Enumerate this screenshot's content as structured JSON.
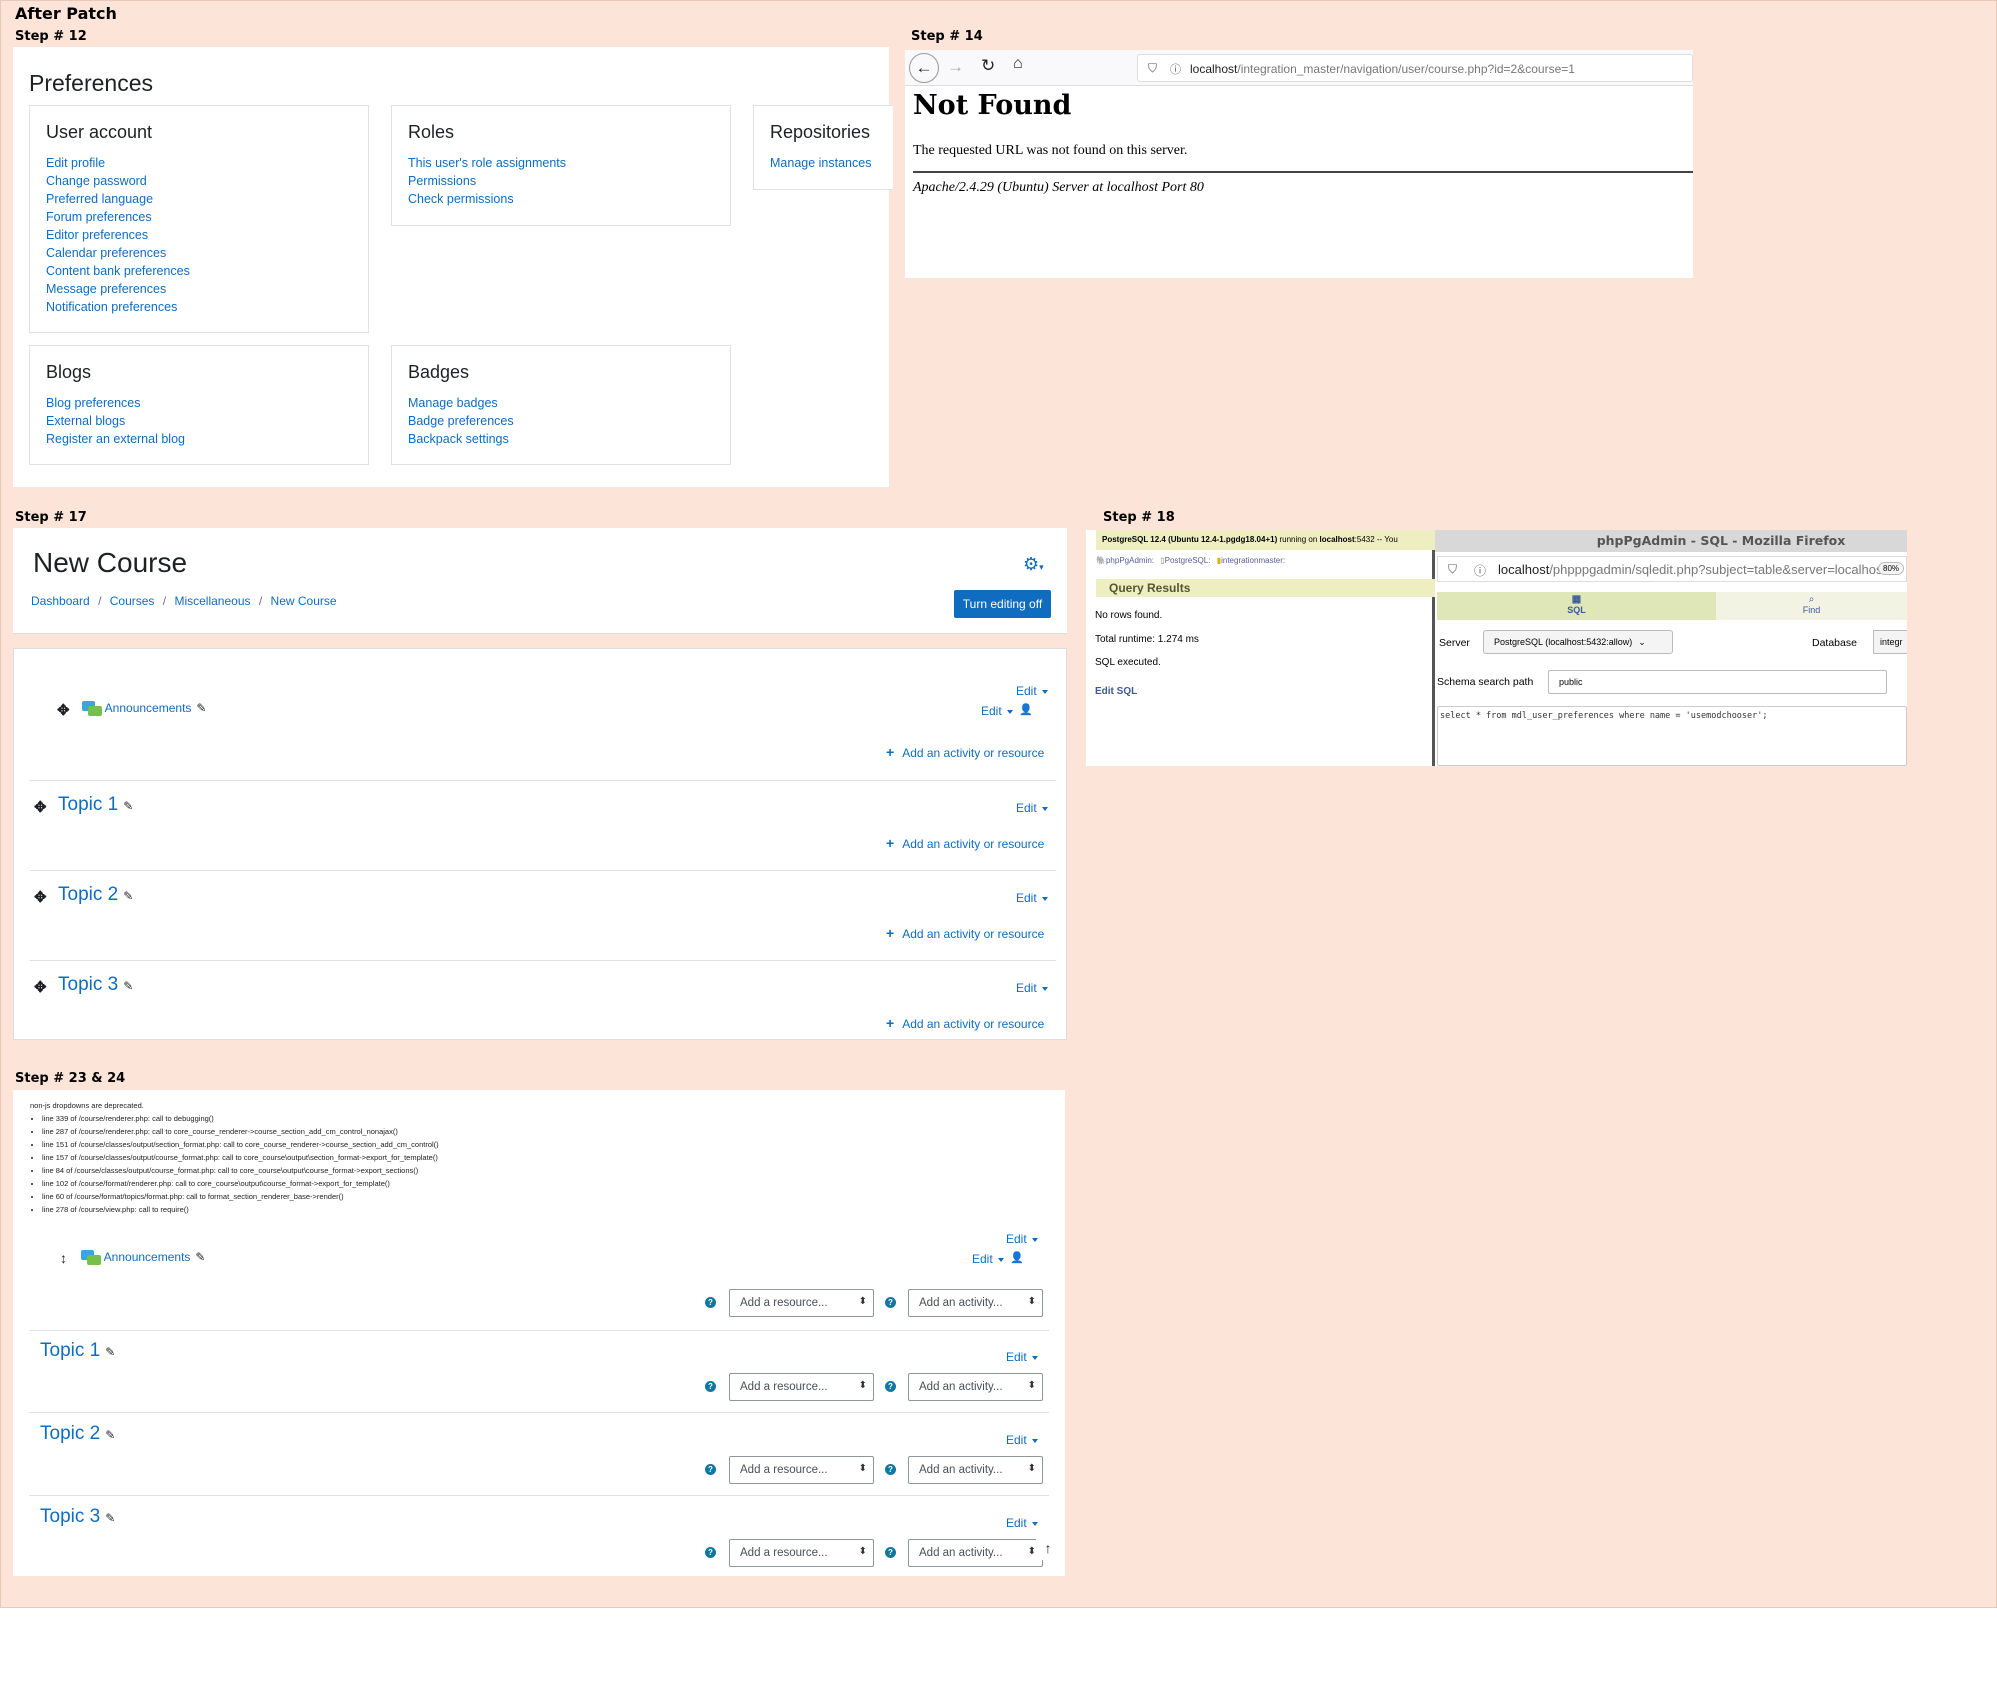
{
  "title": "After Patch",
  "steps": {
    "s12": "Step # 12",
    "s14": "Step # 14",
    "s17": "Step # 17",
    "s18": "Step # 18",
    "s2324": "Step # 23 & 24"
  },
  "preferences": {
    "title": "Preferences",
    "user_account": {
      "heading": "User account",
      "links": [
        "Edit profile",
        "Change password",
        "Preferred language",
        "Forum preferences",
        "Editor preferences",
        "Calendar preferences",
        "Content bank preferences",
        "Message preferences",
        "Notification preferences"
      ]
    },
    "roles": {
      "heading": "Roles",
      "links": [
        "This user's role assignments",
        "Permissions",
        "Check permissions"
      ]
    },
    "repositories": {
      "heading": "Repositories",
      "links": [
        "Manage instances"
      ]
    },
    "blogs": {
      "heading": "Blogs",
      "links": [
        "Blog preferences",
        "External blogs",
        "Register an external blog"
      ]
    },
    "badges": {
      "heading": "Badges",
      "links": [
        "Manage badges",
        "Badge preferences",
        "Backpack settings"
      ]
    }
  },
  "notfound": {
    "url_host": "localhost",
    "url_path": "/integration_master/navigation/user/course.php?id=2&course=1",
    "heading": "Not Found",
    "message": "The requested URL was not found on this server.",
    "server": "Apache/2.4.29 (Ubuntu) Server at localhost Port 80"
  },
  "course": {
    "title": "New Course",
    "breadcrumb": [
      "Dashboard",
      "Courses",
      "Miscellaneous",
      "New Course"
    ],
    "breadcrumb_sep": "/",
    "turn_editing": "Turn editing off",
    "edit": "Edit",
    "announcements": "Announcements",
    "add_activity": "Add an activity or resource",
    "topics": [
      "Topic 1",
      "Topic 2",
      "Topic 3"
    ]
  },
  "pgadmin": {
    "window_title": "phpPgAdmin - SQL - Mozilla Firefox",
    "pg_version": "PostgreSQL 12.4 (Ubuntu 12.4-1.pgdg18.04+1)",
    "running_on": "running on",
    "host": "localhost",
    "port_suffix": ":5432 -- You",
    "crumbs": [
      "phpPgAdmin:",
      "PostgreSQL:",
      "integrationmaster:"
    ],
    "query_results": "Query Results",
    "no_rows": "No rows found.",
    "runtime": "Total runtime: 1.274 ms",
    "executed": "SQL executed.",
    "edit_sql": "Edit SQL",
    "url_host": "localhost",
    "url_path": "/phpppgadmin/sqledit.php?subject=table&server=localhos",
    "zoom": "80%",
    "tab_sql": "SQL",
    "tab_find": "Find",
    "server_label": "Server",
    "server_value": "PostgreSQL (localhost:5432:allow)",
    "database_label": "Database",
    "database_value": "integr",
    "schema_label": "Schema search path",
    "schema_value": "public",
    "query": "select * from mdl_user_preferences where name = 'usemodchooser';"
  },
  "debug": {
    "header": "non-js dropdowns are deprecated.",
    "lines": [
      "line 339 of /course/renderer.php: call to debugging()",
      "line 287 of /course/renderer.php: call to core_course_renderer->course_section_add_cm_control_nonajax()",
      "line 151 of /course/classes/output/section_format.php: call to core_course_renderer->course_section_add_cm_control()",
      "line 157 of /course/classes/output/course_format.php: call to core_course\\output\\section_format->export_for_template()",
      "line 84 of /course/classes/output/course_format.php: call to core_course\\output\\course_format->export_sections()",
      "line 102 of /course/format/renderer.php: call to core_course\\output\\course_format->export_for_template()",
      "line 60 of /course/format/topics/format.php: call to format_section_renderer_base->render()",
      "line 278 of /course/view.php: call to require()"
    ],
    "add_resource": "Add a resource...",
    "add_activity": "Add an activity..."
  },
  "colors": {
    "page_bg": "#fce4d8",
    "link": "#0f6cbf",
    "button": "#0f6cbf"
  }
}
